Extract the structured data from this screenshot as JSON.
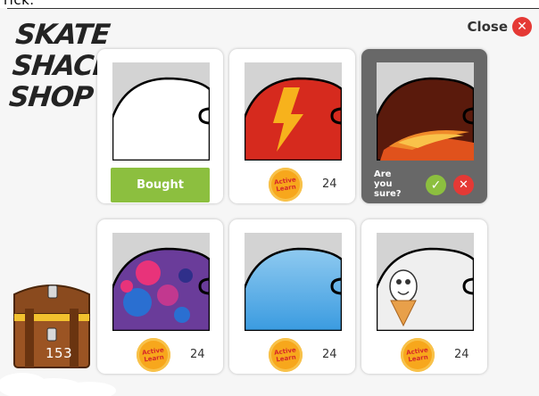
{
  "header": {
    "clipped_text": "rick.",
    "title_lines": [
      "SKATE",
      "SHACK",
      "SHOP"
    ],
    "close_label": "Close",
    "close_icon": "close-circle-icon"
  },
  "colors": {
    "bought_green": "#8cbf3f",
    "close_red": "#e53935",
    "coin_orange": "#f7a71c",
    "selected_card_bg": "#686868"
  },
  "shop": {
    "items": [
      {
        "design": "plain-white",
        "state": "bought",
        "bought_label": "Bought"
      },
      {
        "design": "lightning",
        "state": "for-sale",
        "coin_label": "Active Learn",
        "price": "24"
      },
      {
        "design": "flames",
        "state": "confirming",
        "confirm_text": "Are you sure?",
        "confirm_icon": "check-icon",
        "cancel_icon": "x-icon"
      },
      {
        "design": "paint-splatter",
        "state": "for-sale",
        "coin_label": "Active Learn",
        "price": "24"
      },
      {
        "design": "plain-blue",
        "state": "for-sale",
        "coin_label": "Active Learn",
        "price": "24"
      },
      {
        "design": "ice-cream",
        "state": "for-sale",
        "coin_label": "Active Learn",
        "price": "24"
      }
    ]
  },
  "treasure": {
    "icon": "treasure-chest-icon",
    "count": "153"
  }
}
